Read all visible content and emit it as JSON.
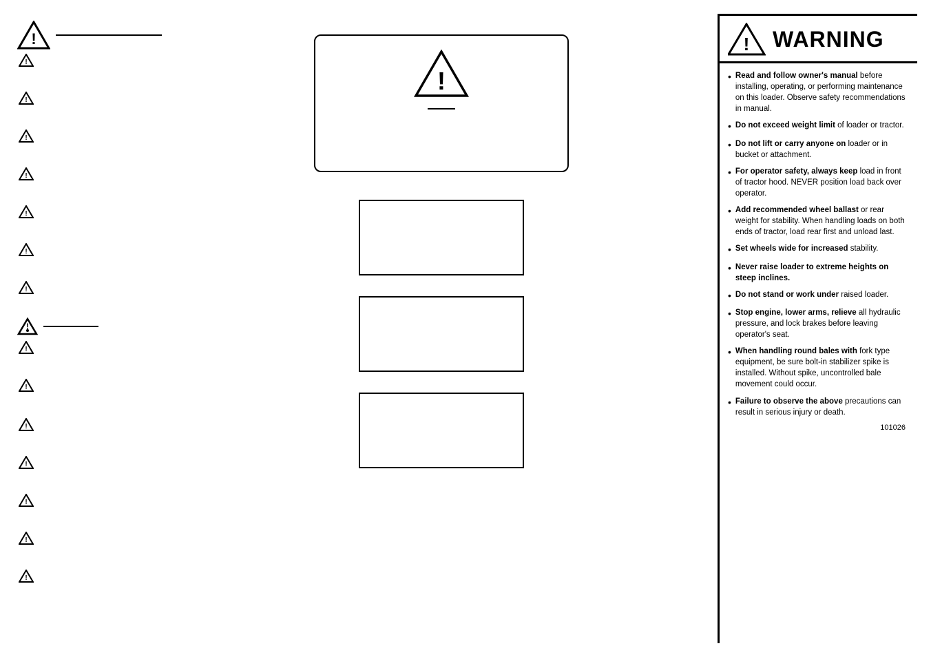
{
  "left": {
    "large_triangle_count": 1,
    "medium_triangle_count": 1,
    "small_triangle_rows": 14
  },
  "middle": {
    "big_box_dash": "—",
    "small_boxes": 3
  },
  "right": {
    "header_text": "WARNING",
    "items": [
      {
        "id": 1,
        "bold_part": "Read and follow owner's manual",
        "rest": " before installing, operating, or performing maintenance on this loader.  Observe safety recommendations in manual."
      },
      {
        "id": 2,
        "bold_part": "Do not exceed weight limit",
        "rest": " of loader or tractor."
      },
      {
        "id": 3,
        "bold_part": "Do not lift or carry anyone on",
        "rest": " loader or in bucket or attachment."
      },
      {
        "id": 4,
        "bold_part": "For operator safety, always keep",
        "rest": " load in front of tractor hood. NEVER position load back over operator."
      },
      {
        "id": 5,
        "bold_part": "Add recommended wheel ballast",
        "rest": " or rear weight for stability. When handling loads on both ends of tractor, load rear first and unload last."
      },
      {
        "id": 6,
        "bold_part": "Set wheels wide for increased",
        "rest": " stability."
      },
      {
        "id": 7,
        "bold_part": "Never raise loader to extreme",
        "rest": " heights on steep inclines."
      },
      {
        "id": 8,
        "bold_part": "Do not stand or work under",
        "rest": " raised loader."
      },
      {
        "id": 9,
        "bold_part": "Stop engine, lower arms, relieve",
        "rest": " all hydraulic pressure, and lock brakes before leaving operator's seat."
      },
      {
        "id": 10,
        "bold_part": "When handling round bales with",
        "rest": " fork type equipment, be sure bolt-in stabilizer spike is installed. Without spike, uncontrolled bale movement could occur."
      },
      {
        "id": 11,
        "bold_part": "Failure to observe the above",
        "rest": " precautions can result in serious injury or death."
      }
    ],
    "part_number": "101026"
  }
}
